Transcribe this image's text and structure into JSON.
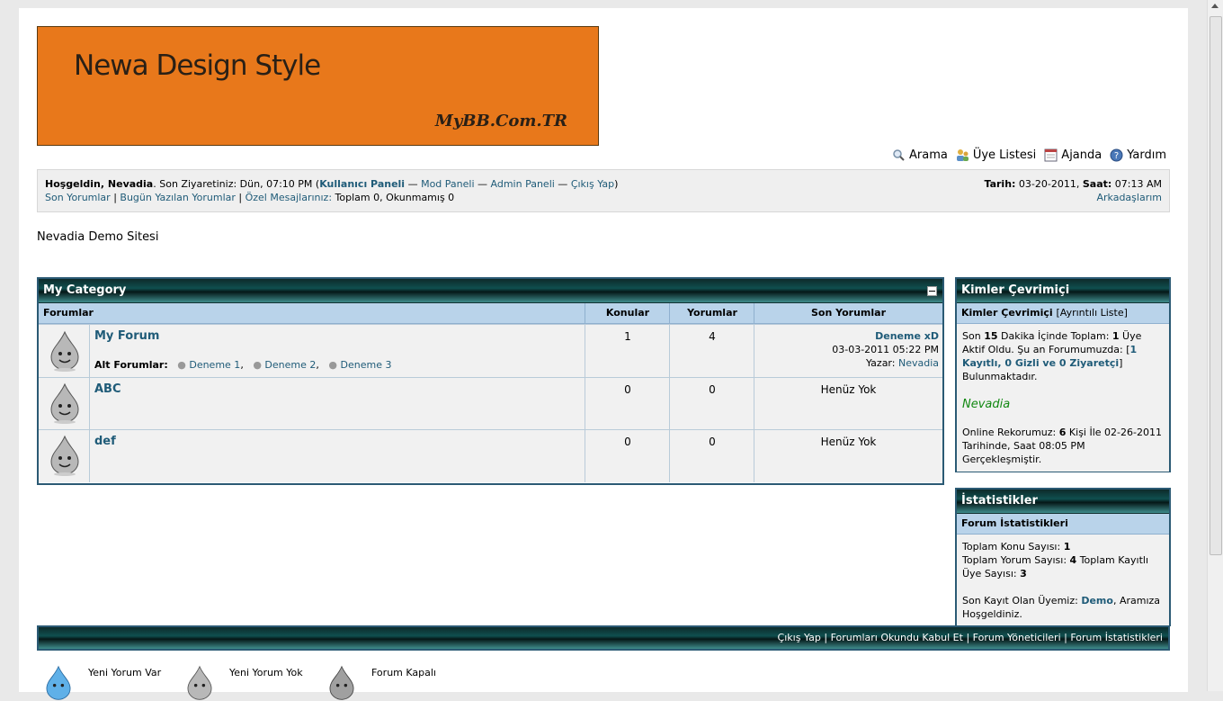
{
  "banner": {
    "title": "Newa Design Style",
    "subtitle": "MyBB.Com.TR"
  },
  "topnav": [
    {
      "label": "Arama",
      "icon": "search-icon"
    },
    {
      "label": "Üye Listesi",
      "icon": "members-icon"
    },
    {
      "label": "Ajanda",
      "icon": "calendar-icon"
    },
    {
      "label": "Yardım",
      "icon": "help-icon"
    }
  ],
  "welcome": {
    "greeting": "Hoşgeldin, Nevadia",
    "last_visit": ". Son Ziyaretiniz: Dün, 07:10 PM (",
    "user_cp": "Kullanıcı Paneli",
    "mod_cp": "Mod Paneli",
    "admin_cp": "Admin Paneli",
    "logout": "Çıkış Yap",
    "sep": " — ",
    "close_paren": ")",
    "recent_posts": "Son Yorumlar",
    "today_posts": "Bugün Yazılan Yorumlar",
    "pm_label": "Özel Mesajlarınız:",
    "pm_counts": " Toplam 0, Okunmamış 0",
    "date_label": "Tarih:",
    "date_value": " 03-20-2011, ",
    "time_label": "Saat:",
    "time_value": " 07:13 AM",
    "friends": "Arkadaşlarım"
  },
  "site_name": "Nevadia Demo Sitesi",
  "category": {
    "title": "My Category",
    "columns": [
      "Forumlar",
      "Konular",
      "Yorumlar",
      "Son Yorumlar"
    ],
    "forums": [
      {
        "name": "My Forum",
        "threads": "1",
        "posts": "4",
        "last_title": "Deneme xD",
        "last_date": "03-03-2011 05:22 PM",
        "last_by_label": "Yazar:",
        "last_by": "Nevadia",
        "sub_label": "Alt Forumlar:",
        "subforums": [
          "Deneme 1",
          "Deneme 2",
          "Deneme 3"
        ]
      },
      {
        "name": "ABC",
        "threads": "0",
        "posts": "0",
        "none": "Henüz Yok"
      },
      {
        "name": "def",
        "threads": "0",
        "posts": "0",
        "none": "Henüz Yok"
      }
    ]
  },
  "online": {
    "title": "Kimler Çevrimiçi",
    "sub_title": "Kimler Çevrimiçi",
    "detail_link": "[Ayrıntılı Liste]",
    "text1a": "Son ",
    "minutes": "15",
    "text1b": " Dakika İçinde Toplam: ",
    "total": "1",
    "text1c": " Üye Aktif Oldu. Şu an Forumumuzda: [",
    "breakdown": "1 Kayıtlı, 0 Gizli ve 0 Ziyaretçi",
    "text1d": "] Bulunmaktadır.",
    "user": "Nevadia",
    "record_a": "Online Rekorumuz: ",
    "record_n": "6",
    "record_b": " Kişi İle 02-26-2011 Tarihinde, Saat 08:05 PM Gerçekleşmiştir."
  },
  "stats": {
    "title": "İstatistikler",
    "sub_title": "Forum İstatistikleri",
    "threads_label": "Toplam Konu Sayısı: ",
    "threads": "1",
    "posts_label": "Toplam Yorum Sayısı: ",
    "posts": "4",
    "members_label": " Toplam Kayıtlı Üye Sayısı: ",
    "members": "3",
    "newest_label": "Son Kayıt Olan Üyemiz: ",
    "newest": "Demo",
    "newest_suffix": ", Aramıza Hoşgeldiniz."
  },
  "footer_links": [
    "Çıkış Yap",
    "Forumları Okundu Kabul Et",
    "Forum Yöneticileri",
    "Forum İstatistikleri"
  ],
  "legend": [
    "Yeni Yorum Var",
    "Yeni Yorum Yok",
    "Forum Kapalı"
  ],
  "colors": {
    "banner": "#e8781b",
    "header_dark": "#0e2a2a",
    "category_bar": "#b9d3ea",
    "link": "#1f5b78",
    "online_user": "#118811"
  }
}
